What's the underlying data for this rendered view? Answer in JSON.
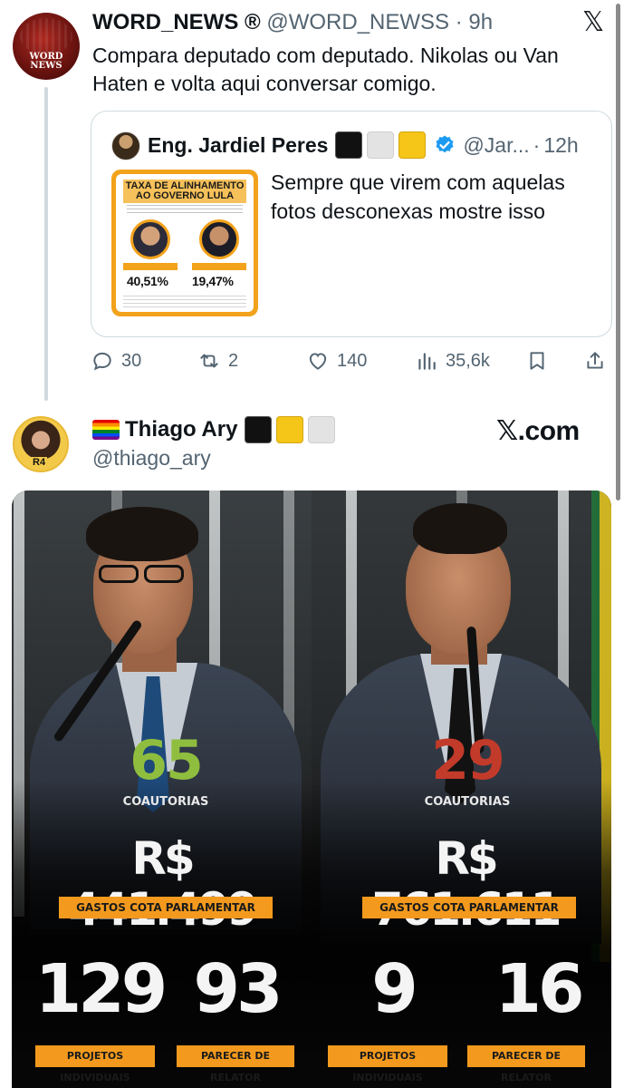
{
  "tweet1": {
    "name": "WORD_NEWS ®",
    "handle": "@WORD_NEWSS",
    "sep": "·",
    "time": "9h",
    "avatar_text": "WORD NEWS",
    "text": "Compara deputado com deputado. Nikolas ou Van Haten e volta aqui conversar comigo.",
    "quote": {
      "name": "Eng. Jardiel Peres",
      "handle": "@Jar...",
      "sep": "·",
      "time": "12h",
      "text": "Sempre que virem com aquelas fotos desconexas mostre isso",
      "thumb": {
        "title": "TAXA DE ALINHAMENTO AO GOVERNO LULA",
        "pct_left": "40,51%",
        "pct_right": "19,47%"
      }
    },
    "actions": {
      "replies": "30",
      "reposts": "2",
      "likes": "140",
      "views": "35,6k"
    }
  },
  "tweet2": {
    "name": "Thiago Ary",
    "handle": "@thiago_ary",
    "site": "𝕏.com",
    "avatar_badge": "R4",
    "media": {
      "left": {
        "coautorias": "65",
        "coautorias_label": "COAUTORIAS",
        "gastos": "R$ 441.499",
        "gastos_label": "GASTOS COTA PARLAMENTAR",
        "projetos": "129",
        "projetos_label": "PROJETOS INDIVIDUAIS",
        "parecer": "93",
        "parecer_label": "PARECER DE RELATOR"
      },
      "right": {
        "coautorias": "29",
        "coautorias_label": "COAUTORIAS",
        "gastos": "R$ 761.611",
        "gastos_label": "GASTOS COTA PARLAMENTAR",
        "projetos": "9",
        "projetos_label": "PROJETOS INDIVIDUAIS",
        "parecer": "16",
        "parecer_label": "PARECER DE RELATOR"
      }
    }
  },
  "colors": {
    "accent_orange": "#f39a1e",
    "green_number": "#8fbe3f",
    "red_number": "#c23a2a",
    "verified_blue": "#1d9bf0",
    "muted_text": "#536471"
  }
}
